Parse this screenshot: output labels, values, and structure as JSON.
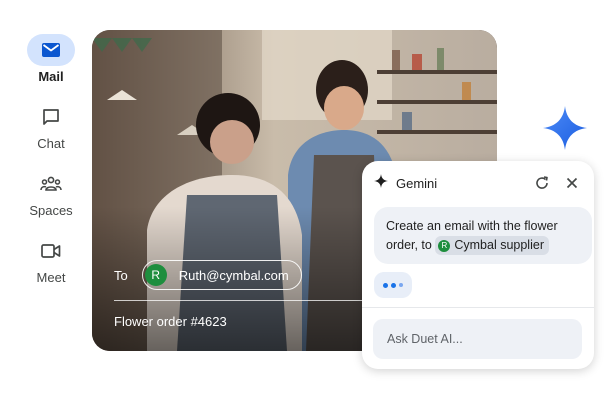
{
  "nav": {
    "items": [
      {
        "label": "Mail",
        "icon": "mail-icon",
        "active": true
      },
      {
        "label": "Chat",
        "icon": "chat-icon",
        "active": false
      },
      {
        "label": "Spaces",
        "icon": "spaces-icon",
        "active": false
      },
      {
        "label": "Meet",
        "icon": "meet-icon",
        "active": false
      }
    ]
  },
  "compose": {
    "to_label": "To",
    "recipient_initial": "R",
    "recipient_email": "Ruth@cymbal.com",
    "subject": "Flower order #4623"
  },
  "gemini": {
    "title": "Gemini",
    "prompt_text": "Create an email with the flower order, to",
    "chip_initial": "R",
    "chip_label": "Cymbal supplier",
    "input_placeholder": "Ask Duet AI..."
  },
  "colors": {
    "accent_blue": "#1a73e8",
    "active_nav_bg": "#d3e3fd",
    "avatar_green": "#1e8e3e"
  }
}
